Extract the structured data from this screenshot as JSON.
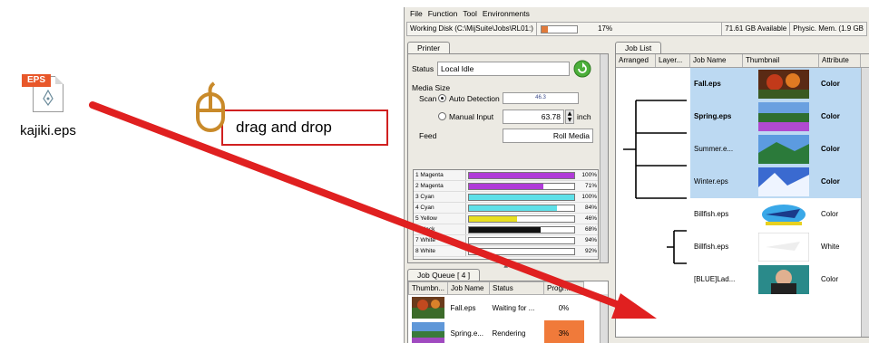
{
  "desktop": {
    "file_badge": "EPS",
    "file_name": "kajiki.eps"
  },
  "annotation": {
    "label": "drag and drop"
  },
  "menu": {
    "items": [
      "File",
      "Function",
      "Tool",
      "Environments"
    ]
  },
  "status": {
    "working_disk": "Working Disk (C:\\MijSuite\\Jobs\\RL01:)",
    "disk_used_percent": "17%",
    "disk_fill": 0.17,
    "available": "71.61 GB Available",
    "physical_memory": "Physic. Mem. (1.9 GB"
  },
  "printer": {
    "tab": "Printer",
    "status_label": "Status",
    "status_value": "Local Idle",
    "media_size_label": "Media Size",
    "scan_label": "Scan",
    "auto_detection_label": "Auto Detection",
    "auto_detection_value": "46.3",
    "manual_input_label": "Manual Input",
    "manual_input_value": "63.78",
    "unit": "inch",
    "feed_label": "Feed",
    "feed_value": "Roll Media",
    "inks": [
      {
        "name": "1 Magenta",
        "percent": "100%",
        "level": 1.0,
        "color": "#b03bd8"
      },
      {
        "name": "2 Magenta",
        "percent": "71%",
        "level": 0.71,
        "color": "#b03bd8"
      },
      {
        "name": "3 Cyan",
        "percent": "100%",
        "level": 1.0,
        "color": "#5ee0e8"
      },
      {
        "name": "4 Cyan",
        "percent": "84%",
        "level": 0.84,
        "color": "#5ee0e8"
      },
      {
        "name": "5 Yellow",
        "percent": "46%",
        "level": 0.46,
        "color": "#e8e020"
      },
      {
        "name": "6 Black",
        "percent": "68%",
        "level": 0.68,
        "color": "#111111"
      },
      {
        "name": "7 White",
        "percent": "94%",
        "level": 0.94,
        "color": "#ffffff"
      },
      {
        "name": "8 White",
        "percent": "92%",
        "level": 0.92,
        "color": "#ffffff"
      }
    ]
  },
  "queue": {
    "tab": "Job Queue [ 4 ]",
    "headers": [
      "Thumbn...",
      "Job Name",
      "Status",
      "Progr..."
    ],
    "rows": [
      {
        "name": "Fall.eps",
        "status": "Waiting for ...",
        "progress": "0%"
      },
      {
        "name": "Spring.e...",
        "status": "Rendering",
        "progress": "3%"
      }
    ]
  },
  "joblist": {
    "tab": "Job List",
    "headers": [
      "Arranged",
      "Layer...",
      "Job Name",
      "Thumbnail",
      "Attribute"
    ],
    "rows": [
      {
        "name": "Fall.eps",
        "attr": "Color",
        "selected": true
      },
      {
        "name": "Spring.eps",
        "attr": "Color",
        "selected": true
      },
      {
        "name": "Summer.e...",
        "attr": "Color",
        "selected": true
      },
      {
        "name": "Winter.eps",
        "attr": "Color",
        "selected": true
      },
      {
        "name": "Billfish.eps",
        "attr": "Color",
        "selected": false
      },
      {
        "name": "Billfish.eps",
        "attr": "White",
        "selected": false
      },
      {
        "name": "[BLUE]Lad...",
        "attr": "Color",
        "selected": false
      }
    ]
  }
}
